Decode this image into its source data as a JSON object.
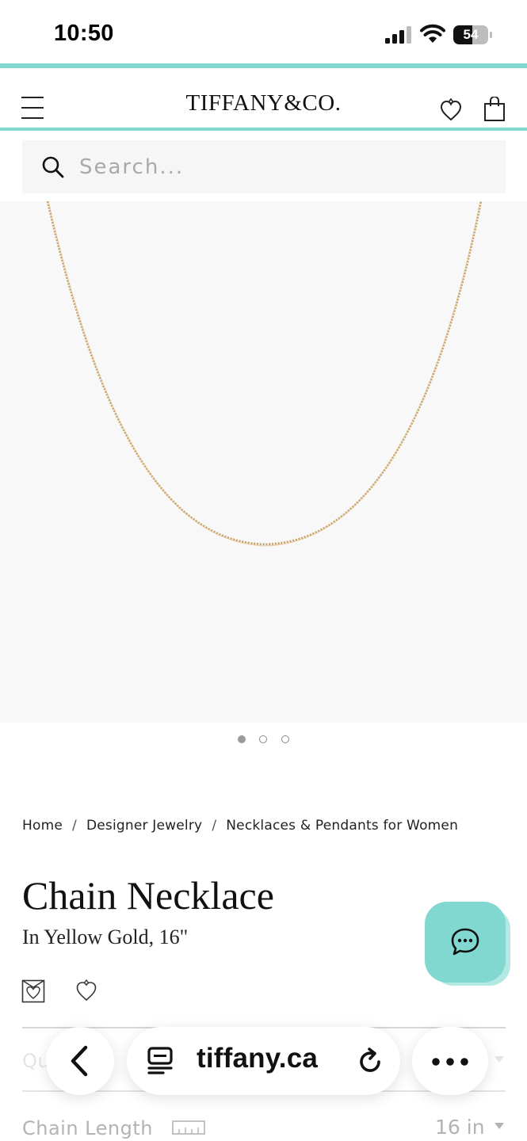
{
  "status_bar": {
    "time": "10:50",
    "battery": "54",
    "battery_level": 0.54
  },
  "header": {
    "logo": "TIFFANY&CO."
  },
  "search": {
    "placeholder": "Search..."
  },
  "carousel": {
    "slide_count": 3,
    "active_index": 0
  },
  "breadcrumb": {
    "items": [
      "Home",
      "Designer Jewelry",
      "Necklaces & Pendants for Women"
    ],
    "separator": "/"
  },
  "product": {
    "title": "Chain Necklace",
    "subtitle": "In Yellow Gold, 16\""
  },
  "options": {
    "quantity_label": "Qu",
    "chain_length_label": "Chain Length",
    "chain_length_value": "16 in"
  },
  "browser": {
    "url": "tiffany.ca"
  },
  "colors": {
    "tiffany_blue": "#81d8d0",
    "gold": "#c9a36a"
  },
  "icons": [
    "menu-icon",
    "wishlist-heart-icon",
    "shopping-bag-icon",
    "search-icon",
    "gift-icon",
    "heart-icon",
    "chat-icon",
    "ruler-icon",
    "back-arrow-icon",
    "tabs-icon",
    "reload-icon",
    "more-icon"
  ]
}
